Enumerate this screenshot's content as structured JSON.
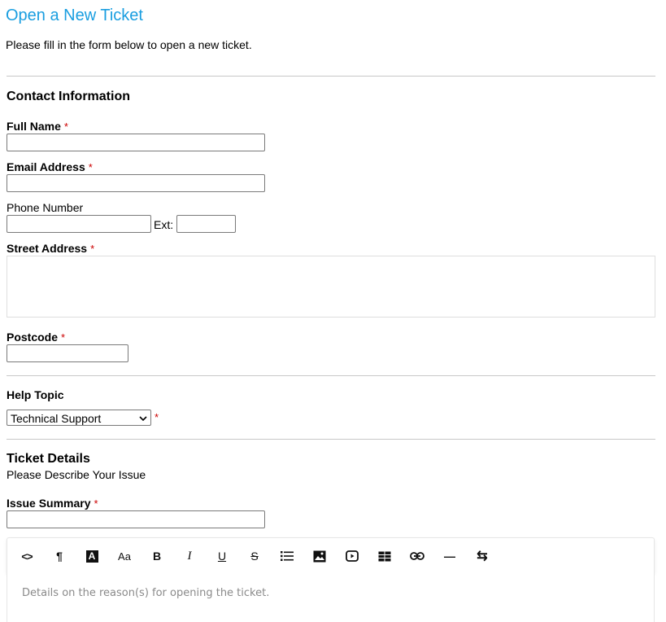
{
  "page": {
    "title": "Open a New Ticket",
    "intro": "Please fill in the form below to open a new ticket."
  },
  "contact": {
    "heading": "Contact Information",
    "full_name_label": "Full Name",
    "email_label": "Email Address",
    "phone_label": "Phone Number",
    "ext_label": "Ext:",
    "street_label": "Street Address",
    "postcode_label": "Postcode",
    "required_mark": "*"
  },
  "help_topic": {
    "label": "Help Topic",
    "selected": "Technical Support",
    "required_mark": "*"
  },
  "ticket": {
    "heading": "Ticket Details",
    "subheading": "Please Describe Your Issue",
    "summary_label": "Issue Summary",
    "required_mark": "*",
    "details_placeholder": "Details on the reason(s) for opening the ticket."
  },
  "toolbar": {
    "buttons": [
      {
        "name": "code-view",
        "glyph": "<>"
      },
      {
        "name": "paragraph",
        "glyph": "¶"
      },
      {
        "name": "font-color",
        "glyph": "A"
      },
      {
        "name": "font-size",
        "glyph": "Aa"
      },
      {
        "name": "bold",
        "glyph": "B"
      },
      {
        "name": "italic",
        "glyph": "I"
      },
      {
        "name": "underline",
        "glyph": "U"
      },
      {
        "name": "strikethrough",
        "glyph": "S"
      },
      {
        "name": "list",
        "glyph": "list"
      },
      {
        "name": "image",
        "glyph": "image"
      },
      {
        "name": "video",
        "glyph": "video"
      },
      {
        "name": "table",
        "glyph": "table"
      },
      {
        "name": "link",
        "glyph": "link"
      },
      {
        "name": "horizontal-rule",
        "glyph": "—"
      },
      {
        "name": "text-direction",
        "glyph": "⇆"
      }
    ]
  },
  "colors": {
    "title": "#1a9ee0",
    "required": "#cc0000"
  }
}
